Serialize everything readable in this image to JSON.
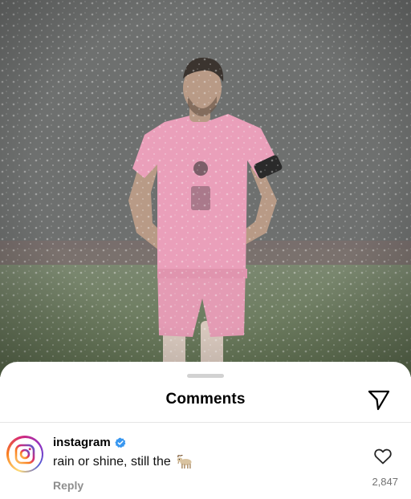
{
  "sheet": {
    "title": "Comments"
  },
  "comment": {
    "username": "instagram",
    "verified": true,
    "text": "rain or shine, still the",
    "emoji_icon": "goat-emoji",
    "reply_label": "Reply",
    "like_count": "2,847"
  },
  "icons": {
    "share": "paper-plane-icon",
    "like": "heart-outline-icon",
    "verified": "verified-badge-icon",
    "avatar": "instagram-logo-icon"
  },
  "colors": {
    "kit_pink": "#e8a2b8",
    "verified_blue": "#3897f0",
    "secondary_text": "#8e8e8e"
  }
}
